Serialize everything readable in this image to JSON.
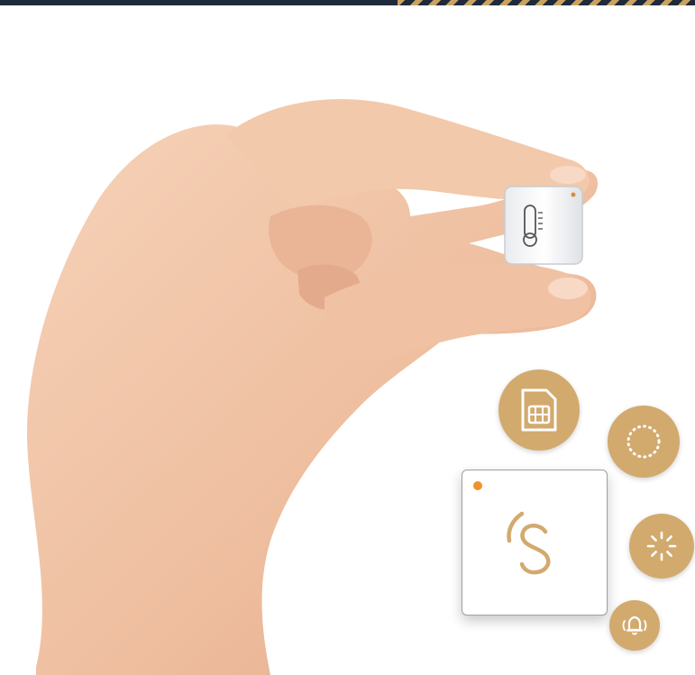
{
  "colors": {
    "accent_gold": "#d2aa6e",
    "orange_dot": "#f0922b",
    "top_bar": "#1f2a3d",
    "skin": "#f2c6a8"
  },
  "icons": {
    "device_icon": "thermometer-icon",
    "badge_1": "sim-card-icon",
    "badge_2": "dotted-circle-icon",
    "badge_3": "loading-spinner-icon",
    "badge_4": "bell-icon",
    "card_logo": "s-logo-icon"
  }
}
